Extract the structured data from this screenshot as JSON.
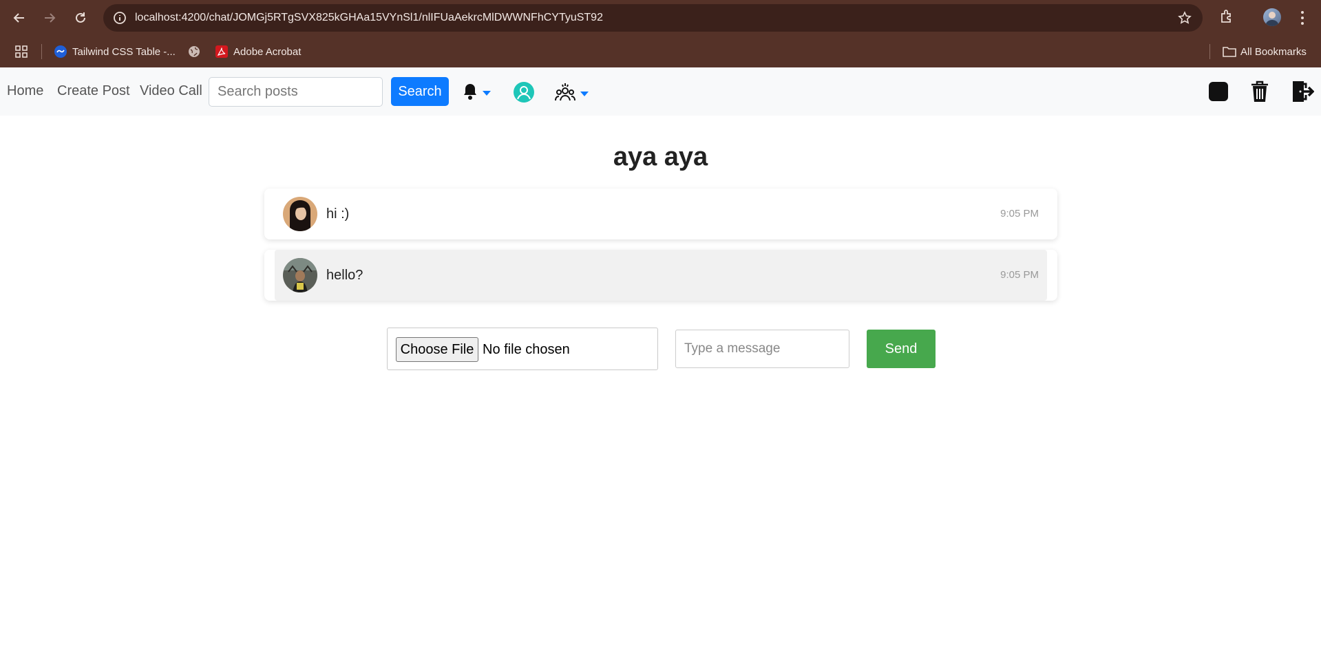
{
  "browser": {
    "url": "localhost:4200/chat/JOMGj5RTgSVX825kGHAa15VYnSl1/nlIFUaAekrcMlDWWNFhCYTyuST92",
    "bookmarks": [
      {
        "label": "Tailwind CSS Table -...",
        "icon": "tailwind-favicon"
      },
      {
        "label": "",
        "icon": "globe-icon"
      },
      {
        "label": "Adobe Acrobat",
        "icon": "acrobat-icon"
      }
    ],
    "all_bookmarks_label": "All Bookmarks"
  },
  "navbar": {
    "links": [
      "Home",
      "Create Post",
      "Video Call"
    ],
    "search_placeholder": "Search posts",
    "search_value": "",
    "search_button": "Search",
    "icons": [
      "bell-icon",
      "user-avatar-icon",
      "group-icon",
      "moon-icon",
      "trash-icon",
      "logout-icon"
    ],
    "accent": "#0d7bff"
  },
  "chat": {
    "title": "aya aya",
    "messages": [
      {
        "text": "hi :)",
        "time": "9:05 PM",
        "avatar": "female-avatar",
        "background": "#ffffff"
      },
      {
        "text": "hello?",
        "time": "9:05 PM",
        "avatar": "male-avatar",
        "background": "#f1f1f1"
      }
    ]
  },
  "composer": {
    "file_button": "Choose File",
    "file_status": "No file chosen",
    "message_placeholder": "Type a message",
    "message_value": "",
    "send_button": "Send",
    "send_color": "#47a84d"
  }
}
